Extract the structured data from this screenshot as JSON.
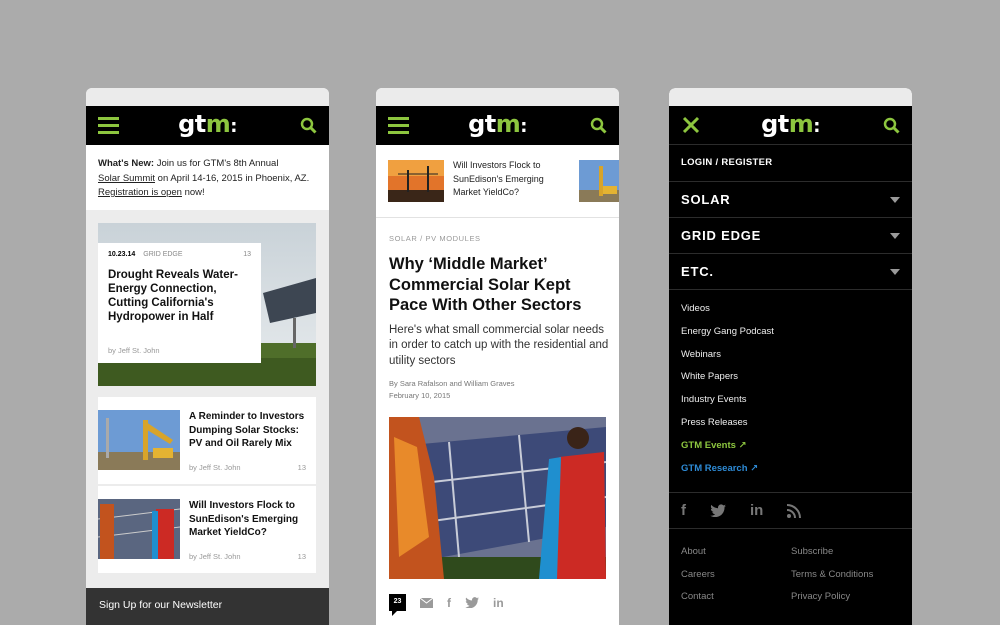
{
  "brand": {
    "logo_text": "gt",
    "logo_accent": "m",
    "logo_colon": ":",
    "accent_color": "#8dc63f"
  },
  "phone1": {
    "whats_new": {
      "label": "What's New:",
      "line1_rest": " Join us for GTM's 8th Annual",
      "link1": "Solar Summit",
      "line2_rest": " on April 14-16, 2015 in Phoenix, AZ.",
      "link2": "Registration is open",
      "line3_rest": " now!"
    },
    "hero": {
      "date": "10.23.14",
      "category": "GRID EDGE",
      "count": "13",
      "title": "Drought Reveals Water-Energy Connection, Cutting California's Hydropower in Half",
      "byline": "by Jeff St. John"
    },
    "stories": [
      {
        "title": "A Reminder to Investors Dumping Solar Stocks: PV and Oil Rarely Mix",
        "byline": "by Jeff St. John",
        "count": "13"
      },
      {
        "title": "Will Investors Flock to SunEdison's Emerging Market YieldCo?",
        "byline": "by Jeff St. John",
        "count": "13"
      }
    ],
    "newsletter": "Sign Up for our Newsletter"
  },
  "phone2": {
    "teaser_title": "Will Investors Flock to SunEdison's Emerging Market YieldCo?",
    "kicker": "SOLAR / PV MODULES",
    "title": "Why ‘Middle Market’ Commercial Solar Kept Pace With Other Sectors",
    "dek": "Here's what small commercial solar needs in order to catch up with the residential and utility sectors",
    "authors": "By Sara Rafalson and William Graves",
    "date": "February 10, 2015",
    "comment_count": "23"
  },
  "phone3": {
    "login": "LOGIN / REGISTER",
    "sections": [
      "SOLAR",
      "GRID EDGE",
      "ETC."
    ],
    "links": [
      "Videos",
      "Energy Gang Podcast",
      "Webinars",
      "White Papers",
      "Industry Events",
      "Press Releases"
    ],
    "gtm_events": "GTM Events ↗",
    "gtm_research": "GTM Research ↗",
    "social": {
      "facebook": "f",
      "linkedin": "in"
    },
    "footer": {
      "about": "About",
      "subscribe": "Subscribe",
      "careers": "Careers",
      "terms": "Terms & Conditions",
      "contact": "Contact",
      "privacy": "Privacy Policy"
    }
  }
}
